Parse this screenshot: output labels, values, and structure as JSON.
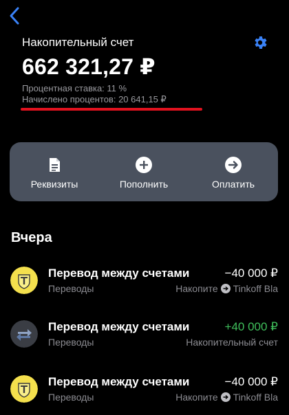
{
  "nav": {
    "back_icon": "chevron-left-icon",
    "settings_icon": "gear-icon"
  },
  "account": {
    "title": "Накопительный счет",
    "balance": "662 321,27 ₽",
    "rate": "Процентная ставка: 11 %",
    "accrued": "Начислено процентов: 20 641,15 ₽"
  },
  "actions": [
    {
      "label": "Реквизиты",
      "icon": "document-icon"
    },
    {
      "label": "Пополнить",
      "icon": "plus-circle-icon"
    },
    {
      "label": "Оплатить",
      "icon": "arrow-right-circle-icon"
    }
  ],
  "history": {
    "section_title": "Вчера",
    "items": [
      {
        "title": "Перевод между счетами",
        "category": "Переводы",
        "amount": "−40 000 ₽",
        "from": "Накопите",
        "to": "Tinkoff Bla",
        "avatar": "tinkoff-logo-icon"
      },
      {
        "title": "Перевод между счетами",
        "category": "Переводы",
        "amount": "+40 000 ₽",
        "account": "Накопительный счет",
        "avatar": "transfer-arrows-icon"
      },
      {
        "title": "Перевод между счетами",
        "category": "Переводы",
        "amount": "−40 000 ₽",
        "from": "Накопите",
        "to": "Tinkoff Bla",
        "avatar": "tinkoff-logo-icon"
      }
    ]
  },
  "colors": {
    "accent": "#3a82f7",
    "positive": "#3fbf5b",
    "underline": "#e2121f",
    "card": "#4a515e"
  }
}
